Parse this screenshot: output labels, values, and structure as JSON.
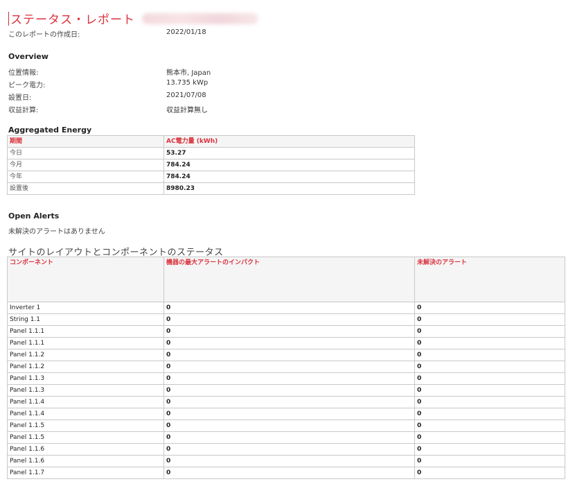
{
  "header": {
    "title": "ステータス・レポート",
    "created_label": "このレポートの作成日:",
    "created_value": "2022/01/18"
  },
  "overview": {
    "heading": "Overview",
    "location_label": "位置情報:",
    "location_value": "熊本市, Japan",
    "peak_label": "ピーク電力:",
    "peak_value": "13.735 kWp",
    "install_label": "設置日:",
    "install_value": "2021/07/08",
    "revenue_label": "収益計算:",
    "revenue_value": "収益計算無し"
  },
  "energy": {
    "heading": "Aggregated Energy",
    "col_period": "期間",
    "col_ac": "AC電力量 (kWh)",
    "rows": [
      {
        "period": "今日",
        "value": "53.27"
      },
      {
        "period": "今月",
        "value": "784.24"
      },
      {
        "period": "今年",
        "value": "784.24"
      },
      {
        "period": "設置後",
        "value": "8980.23"
      }
    ]
  },
  "alerts": {
    "heading": "Open Alerts",
    "text": "未解決のアラートはありません"
  },
  "components": {
    "heading": "サイトのレイアウトとコンポーネントのステータス",
    "col_component": "コンポーネント",
    "col_impact": "機器の最大アラートのインパクト",
    "col_open": "未解決のアラート",
    "rows": [
      {
        "name": "Inverter 1",
        "impact": "0",
        "open": "0"
      },
      {
        "name": "String 1.1",
        "impact": "0",
        "open": "0"
      },
      {
        "name": "Panel 1.1.1",
        "impact": "0",
        "open": "0"
      },
      {
        "name": "Panel 1.1.1",
        "impact": "0",
        "open": "0"
      },
      {
        "name": "Panel 1.1.2",
        "impact": "0",
        "open": "0"
      },
      {
        "name": "Panel 1.1.2",
        "impact": "0",
        "open": "0"
      },
      {
        "name": "Panel 1.1.3",
        "impact": "0",
        "open": "0"
      },
      {
        "name": "Panel 1.1.3",
        "impact": "0",
        "open": "0"
      },
      {
        "name": "Panel 1.1.4",
        "impact": "0",
        "open": "0"
      },
      {
        "name": "Panel 1.1.4",
        "impact": "0",
        "open": "0"
      },
      {
        "name": "Panel 1.1.5",
        "impact": "0",
        "open": "0"
      },
      {
        "name": "Panel 1.1.5",
        "impact": "0",
        "open": "0"
      },
      {
        "name": "Panel 1.1.6",
        "impact": "0",
        "open": "0"
      },
      {
        "name": "Panel 1.1.6",
        "impact": "0",
        "open": "0"
      },
      {
        "name": "Panel 1.1.7",
        "impact": "0",
        "open": "0"
      }
    ]
  }
}
